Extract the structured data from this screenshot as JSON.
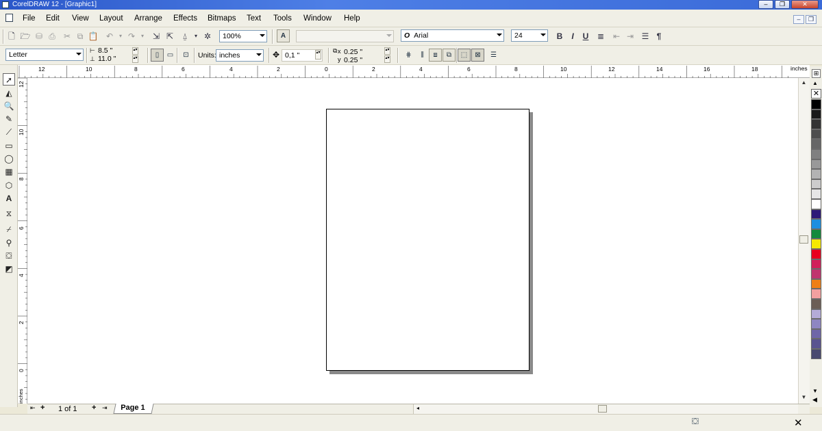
{
  "window": {
    "title": "CorelDRAW 12 - [Graphic1]",
    "minimize": "–",
    "restore": "❐",
    "close": "✕"
  },
  "menubar": {
    "items": [
      "File",
      "Edit",
      "View",
      "Layout",
      "Arrange",
      "Effects",
      "Bitmaps",
      "Text",
      "Tools",
      "Window",
      "Help"
    ]
  },
  "standard_toolbar": {
    "zoom_value": "100%",
    "font_name": "Arial",
    "font_size": "24",
    "bold": "B",
    "italic": "I",
    "underline": "U",
    "paragraph": "¶"
  },
  "property_bar": {
    "paper_type": "Letter",
    "paper_width": "8.5 \"",
    "paper_height": "11.0 \"",
    "units_label": "Units:",
    "units_value": "inches",
    "nudge_value": "0,1 \"",
    "duplicate_x": "0.25 \"",
    "duplicate_y": "0.25 \"",
    "x_label": "x",
    "y_label": "y"
  },
  "rulers": {
    "unit": "inches",
    "horizontal_ticks": [
      "12",
      "10",
      "8",
      "6",
      "4",
      "2",
      "0",
      "2",
      "4",
      "6",
      "8",
      "10",
      "12",
      "14",
      "16",
      "18"
    ],
    "vertical_ticks": [
      "12",
      "10",
      "8",
      "6",
      "4",
      "2",
      "0"
    ]
  },
  "navigator": {
    "page_count": "1 of 1",
    "page_tab": "Page 1",
    "first": "⇤",
    "add_before": "+",
    "add_after": "+",
    "last": "⇥"
  },
  "palette_colors": [
    "#000000",
    "#1a1a1a",
    "#333333",
    "#4d4d4d",
    "#666666",
    "#808080",
    "#999999",
    "#b3b3b3",
    "#cccccc",
    "#e6e6e6",
    "#ffffff",
    "#2e1a78",
    "#1c8ee0",
    "#138a3c",
    "#f5e800",
    "#e8001e",
    "#d0205a",
    "#c0346e",
    "#ee7f16",
    "#f3a0a0",
    "#6b5e55",
    "#b4abd8",
    "#8e86c2",
    "#6f66a8",
    "#5a5390",
    "#4a4a70"
  ]
}
